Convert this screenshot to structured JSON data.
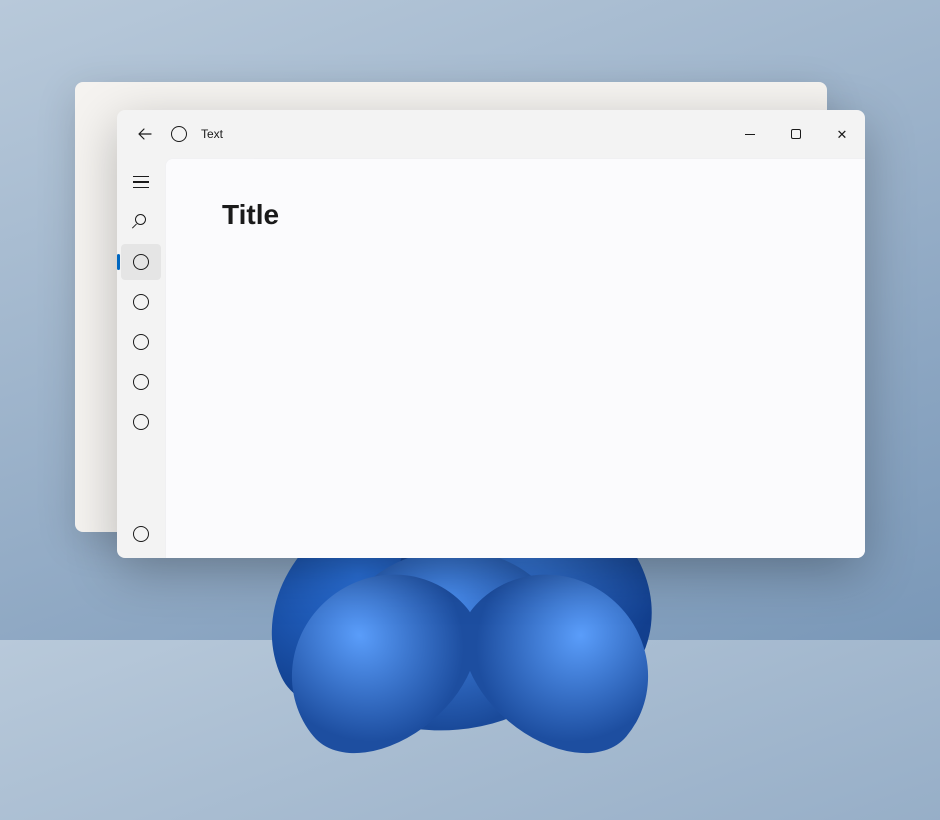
{
  "window": {
    "title": "Text"
  },
  "page": {
    "heading": "Title"
  },
  "nav": {
    "items": [
      {
        "kind": "hamburger",
        "selected": false
      },
      {
        "kind": "search",
        "selected": false
      },
      {
        "kind": "circle",
        "selected": true
      },
      {
        "kind": "circle",
        "selected": false
      },
      {
        "kind": "circle",
        "selected": false
      },
      {
        "kind": "circle",
        "selected": false
      },
      {
        "kind": "circle",
        "selected": false
      }
    ],
    "footer": {
      "kind": "circle"
    }
  }
}
